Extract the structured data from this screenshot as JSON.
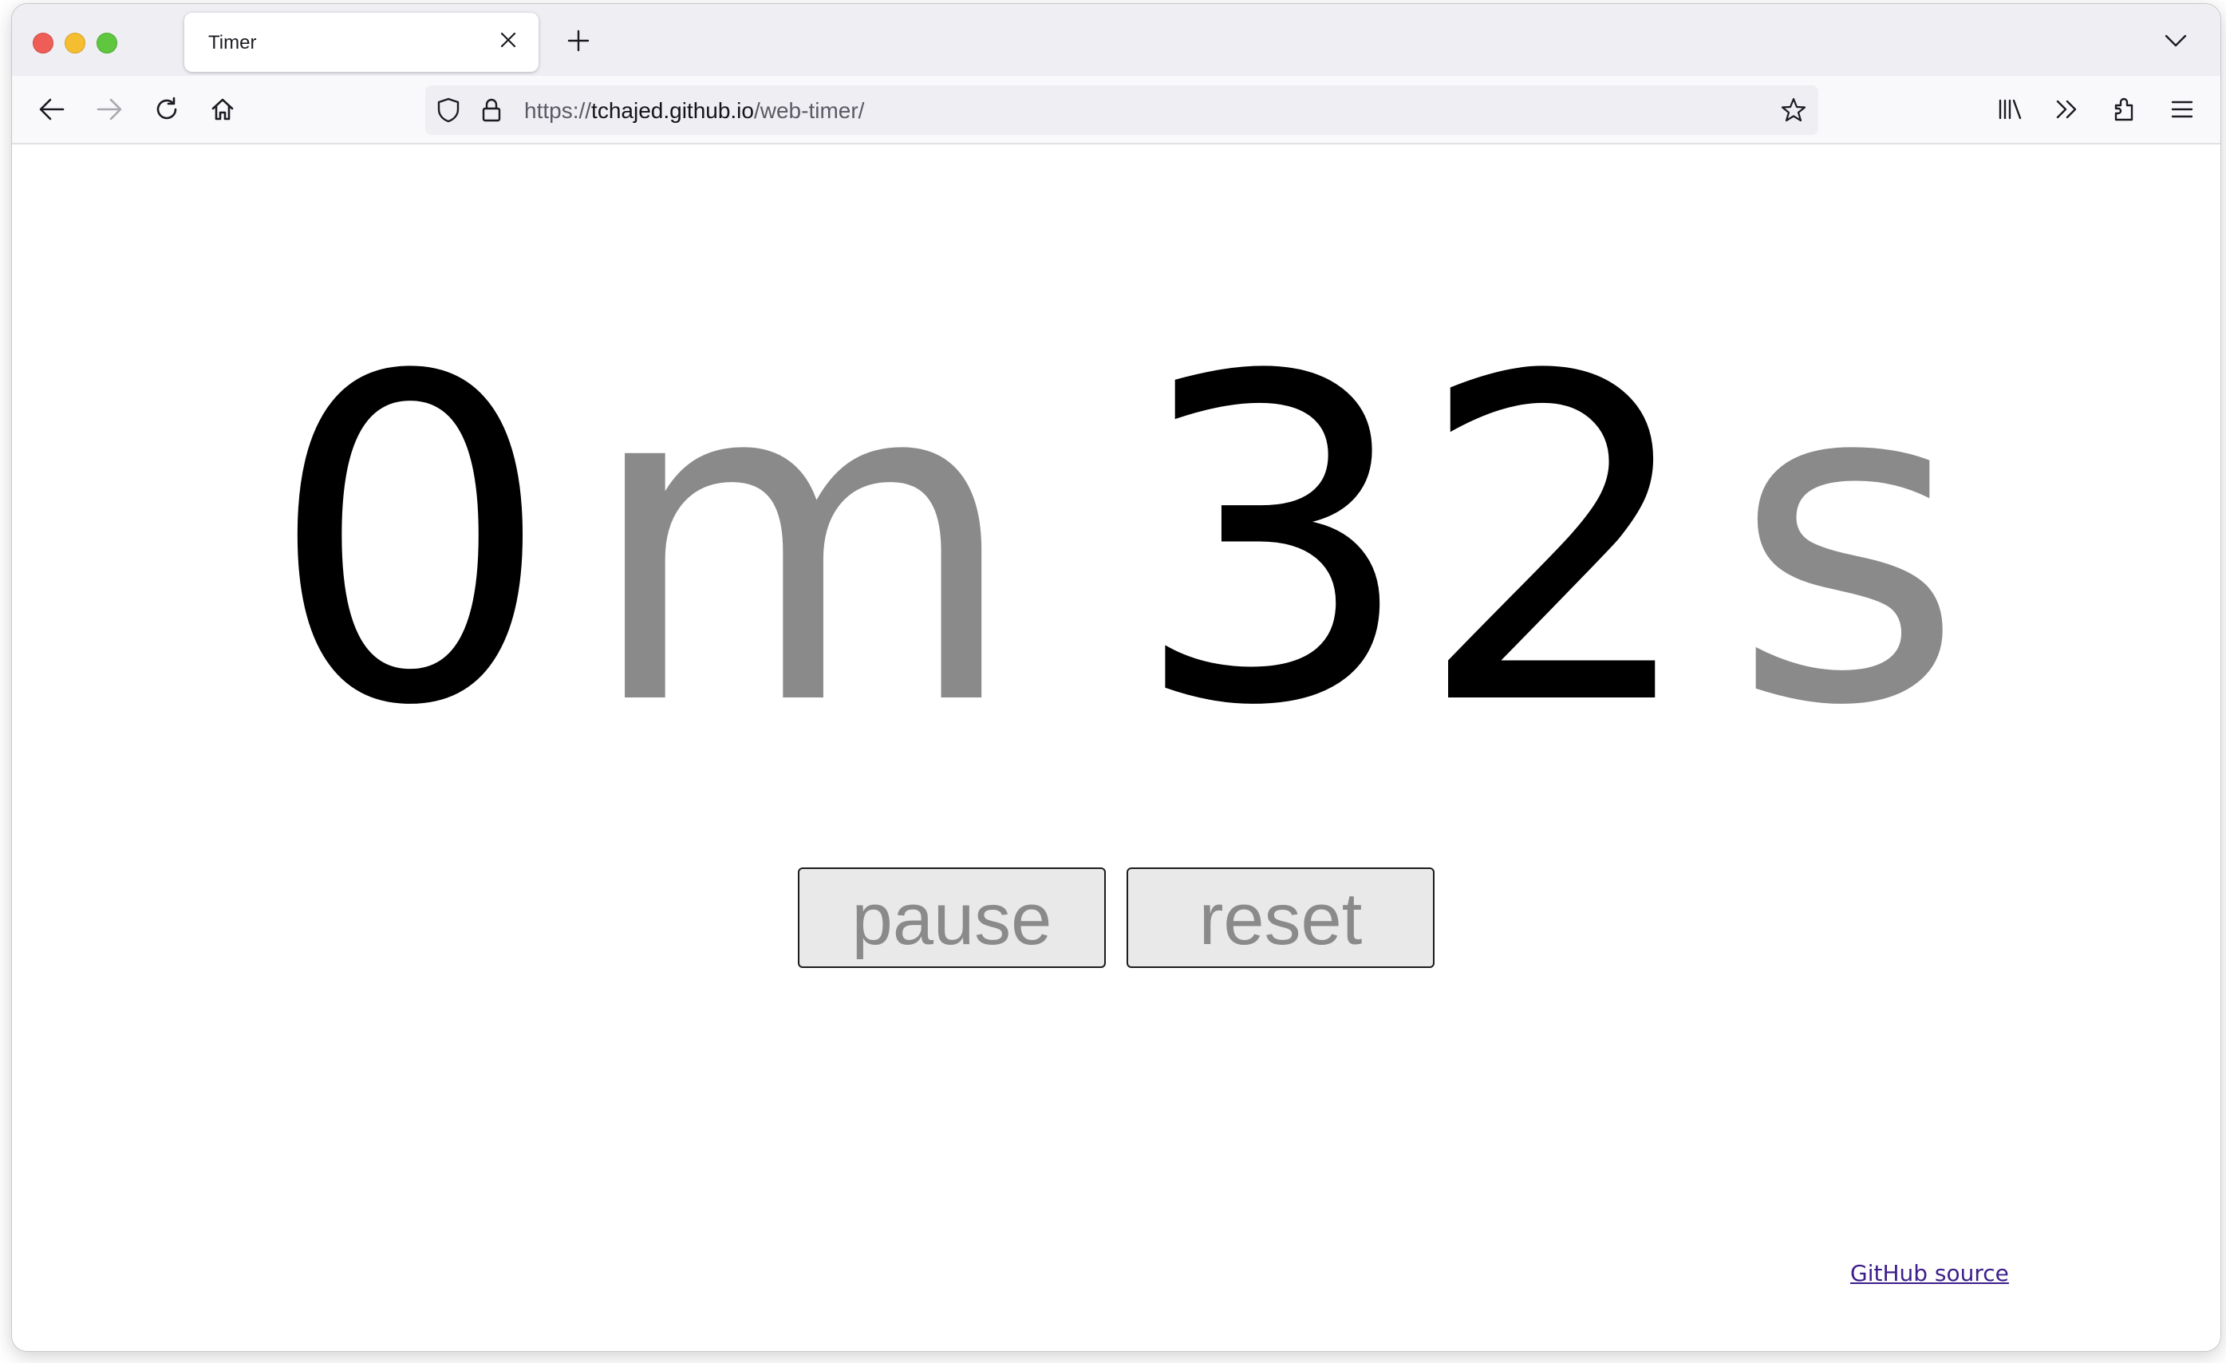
{
  "browser": {
    "tab": {
      "title": "Timer"
    },
    "url": {
      "scheme": "https://",
      "host": "tchajed.github.io",
      "path": "/web-timer/"
    }
  },
  "timer": {
    "minutes": "0",
    "minutes_unit": "m",
    "seconds": "32",
    "seconds_unit": "s"
  },
  "controls": {
    "pause_label": "pause",
    "reset_label": "reset"
  },
  "footer": {
    "link_label": "GitHub source"
  },
  "colors": {
    "digits": "#000000",
    "units": "#8a8a8a",
    "button_bg": "#e9e9ea",
    "link": "#3d1e8a"
  },
  "icons": [
    "close-icon",
    "plus-icon",
    "chevron-down-icon",
    "back-arrow-icon",
    "forward-arrow-icon",
    "reload-icon",
    "home-icon",
    "shield-icon",
    "lock-icon",
    "star-icon",
    "library-icon",
    "overflow-chevrons-icon",
    "extensions-icon",
    "hamburger-menu-icon"
  ]
}
